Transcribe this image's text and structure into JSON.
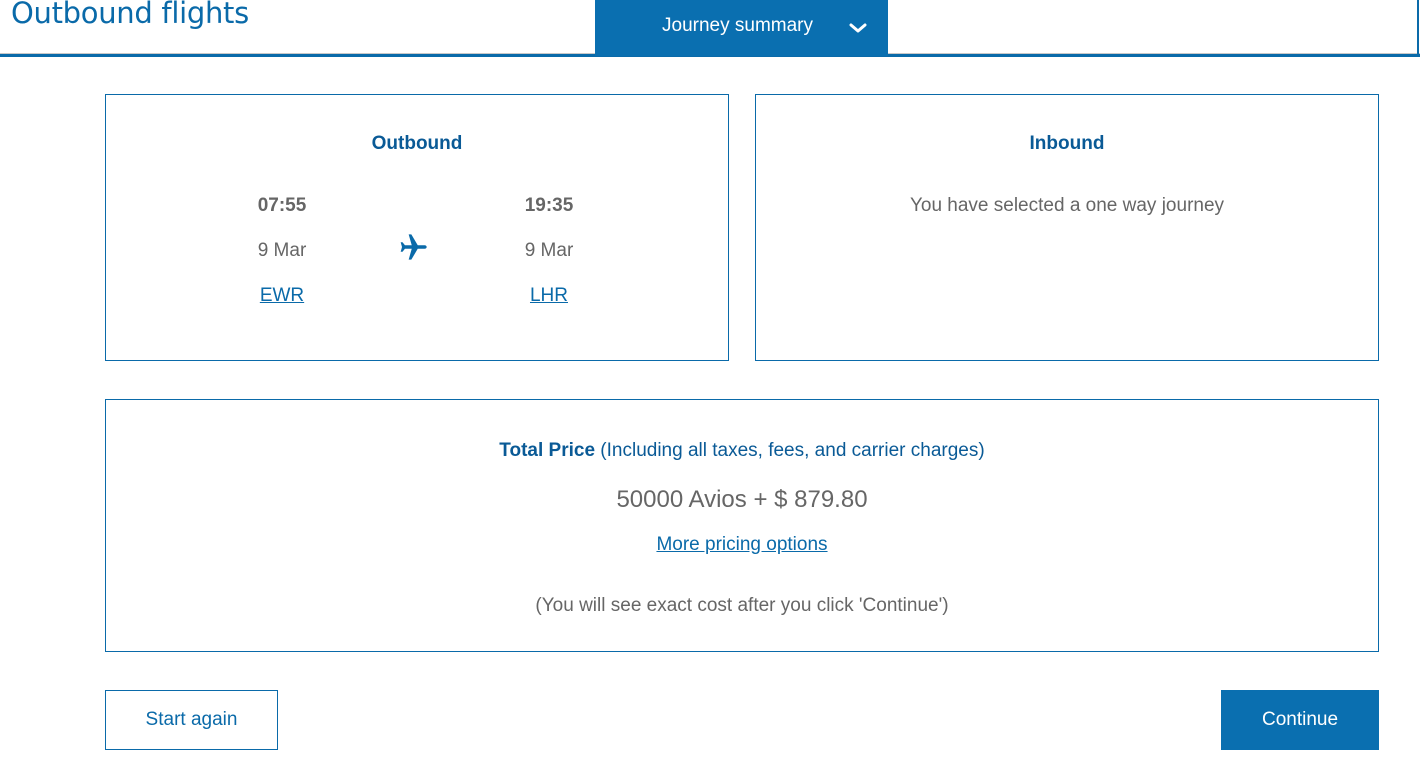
{
  "header": {
    "title": "Outbound flights",
    "journey_summary_label": "Journey summary",
    "journey_summary_icon": "chevron-down-icon"
  },
  "outbound": {
    "title": "Outbound",
    "departure": {
      "time": "07:55",
      "date": "9 Mar",
      "airport": "EWR"
    },
    "arrival": {
      "time": "19:35",
      "date": "9 Mar",
      "airport": "LHR"
    },
    "icon": "airplane-icon"
  },
  "inbound": {
    "title": "Inbound",
    "message": "You have selected a one way journey"
  },
  "price": {
    "heading_bold": "Total Price",
    "heading_rest": " (Including all taxes, fees, and carrier charges)",
    "value": "50000 Avios + $ 879.80",
    "more_options_link": "More pricing options",
    "note": "(You will see exact cost after you click 'Continue')"
  },
  "actions": {
    "start_again": "Start again",
    "continue": "Continue"
  },
  "colors": {
    "brand_blue": "#0a6fb0",
    "heading_blue": "#0a5a96",
    "text_grey": "#666666"
  }
}
